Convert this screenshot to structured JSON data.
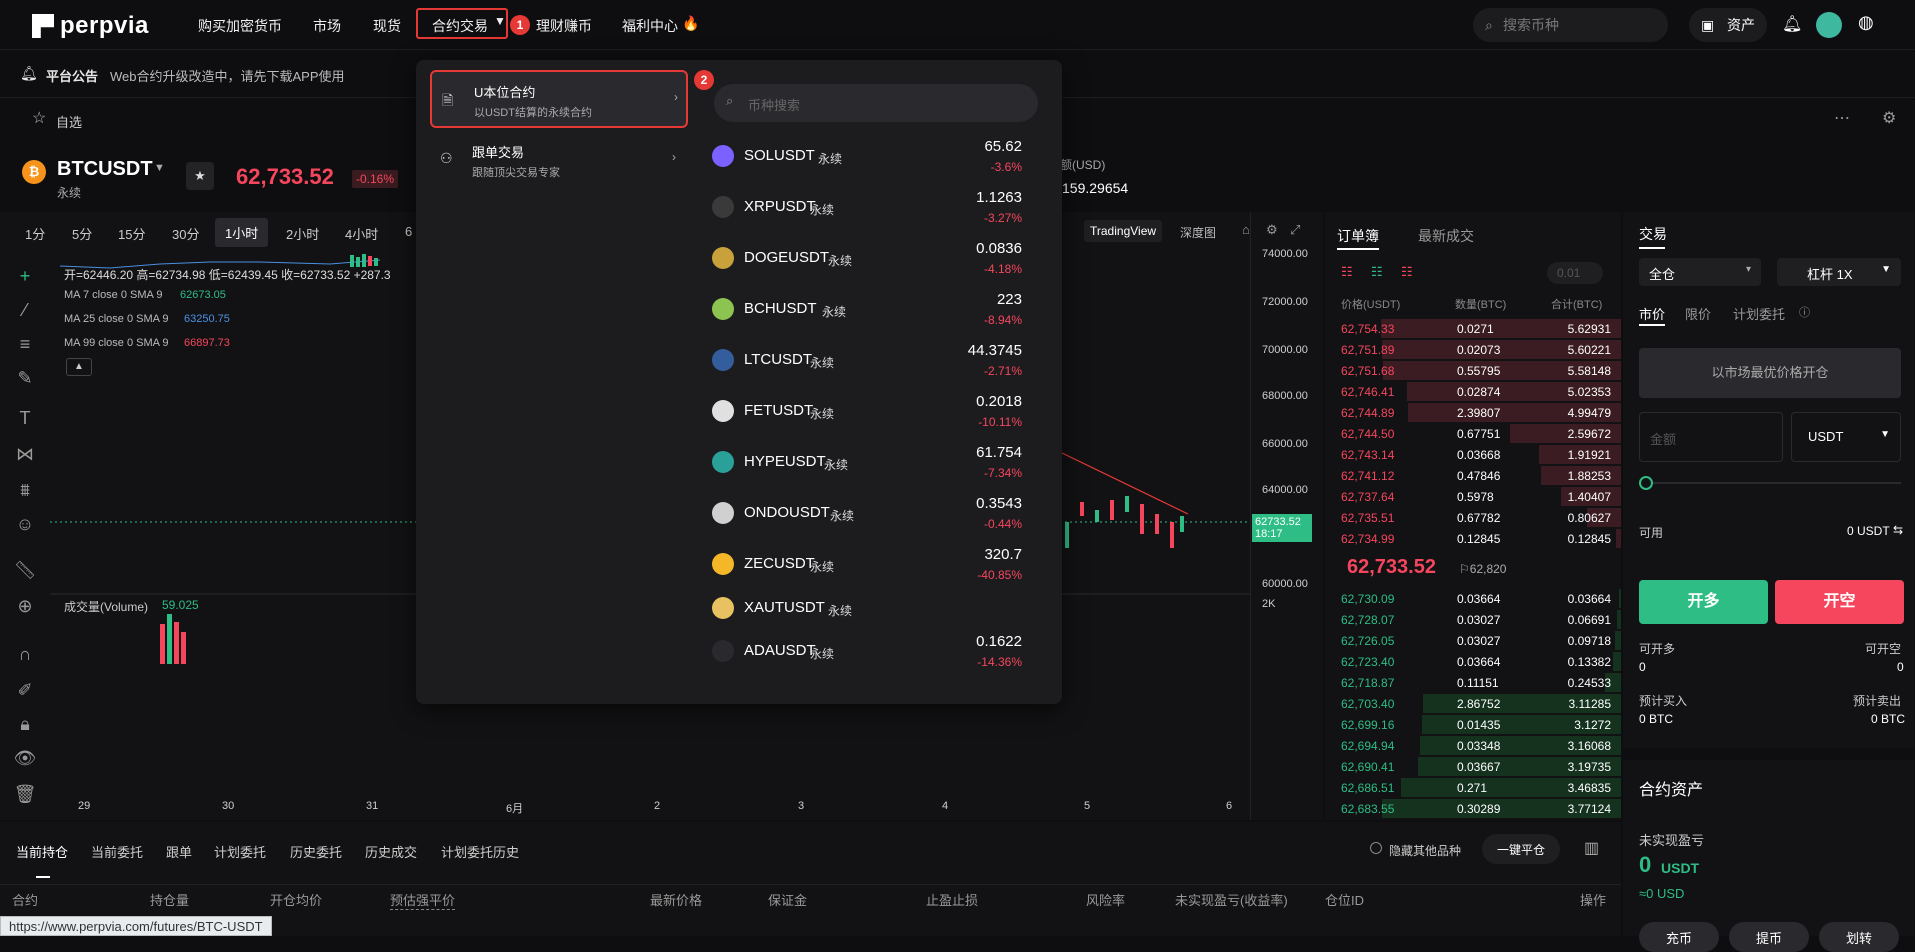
{
  "header": {
    "logo": "perpvia",
    "nav": [
      "购买加密货币",
      "市场",
      "现货",
      "合约交易",
      "理财赚币",
      "福利中心"
    ],
    "badge1": "1",
    "badge2": "2",
    "search_placeholder": "搜索币种",
    "asset_label": "资产"
  },
  "announce": {
    "title": "平台公告",
    "text": "Web合约升级改造中，请先下载APP使用"
  },
  "favrow": {
    "label": "自选"
  },
  "ticker": {
    "symbol": "BTCUSDT",
    "sub": "永续",
    "price": "62,733.52",
    "change": "-0.16%",
    "extra_label": "额(USD)",
    "extra_value": "159.29654"
  },
  "chart": {
    "intervals": [
      "1分",
      "5分",
      "15分",
      "30分",
      "1小时",
      "2小时",
      "4小时",
      "6"
    ],
    "view_tabs": [
      "TradingView",
      "深度图"
    ],
    "ohlc": "开=62446.20 高=62734.98 低=62439.45 收=62733.52 +287.3",
    "ma7": "MA 7 close 0 SMA 9",
    "ma7_val": "62673.05",
    "ma25": "MA 25 close 0 SMA 9",
    "ma25_val": "63250.75",
    "ma99": "MA 99 close 0 SMA 9",
    "ma99_val": "66897.73",
    "volume_label": "成交量(Volume)",
    "volume_val": "59.025",
    "y_labels": [
      "74000.00",
      "72000.00",
      "70000.00",
      "68000.00",
      "66000.00",
      "64000.00",
      "60000.00",
      "2K"
    ],
    "x_labels": [
      "29",
      "30",
      "31",
      "6月",
      "2",
      "3",
      "4",
      "5",
      "6"
    ],
    "last_price": "62733.52",
    "last_time": "18:17"
  },
  "orderbook": {
    "tabs": [
      "订单簿",
      "最新成交"
    ],
    "precision": "0.01",
    "cols": [
      "价格(USDT)",
      "数量(BTC)",
      "合计(BTC)"
    ],
    "asks": [
      [
        "62,754.33",
        "0.0271",
        "5.62931"
      ],
      [
        "62,751.89",
        "0.02073",
        "5.60221"
      ],
      [
        "62,751.68",
        "0.55795",
        "5.58148"
      ],
      [
        "62,746.41",
        "0.02874",
        "5.02353"
      ],
      [
        "62,744.89",
        "2.39807",
        "4.99479"
      ],
      [
        "62,744.50",
        "0.67751",
        "2.59672"
      ],
      [
        "62,743.14",
        "0.03668",
        "1.91921"
      ],
      [
        "62,741.12",
        "0.47846",
        "1.88253"
      ],
      [
        "62,737.64",
        "0.5978",
        "1.40407"
      ],
      [
        "62,735.51",
        "0.67782",
        "0.80627"
      ],
      [
        "62,734.99",
        "0.12845",
        "0.12845"
      ]
    ],
    "mid_price": "62,733.52",
    "mark_price": "62,820",
    "bids": [
      [
        "62,730.09",
        "0.03664",
        "0.03664"
      ],
      [
        "62,728.07",
        "0.03027",
        "0.06691"
      ],
      [
        "62,726.05",
        "0.03027",
        "0.09718"
      ],
      [
        "62,723.40",
        "0.03664",
        "0.13382"
      ],
      [
        "62,718.87",
        "0.11151",
        "0.24533"
      ],
      [
        "62,703.40",
        "2.86752",
        "3.11285"
      ],
      [
        "62,699.16",
        "0.01435",
        "3.1272"
      ],
      [
        "62,694.94",
        "0.03348",
        "3.16068"
      ],
      [
        "62,690.41",
        "0.03667",
        "3.19735"
      ],
      [
        "62,686.51",
        "0.271",
        "3.46835"
      ],
      [
        "62,683.55",
        "0.30289",
        "3.77124"
      ]
    ]
  },
  "trade": {
    "title": "交易",
    "margin_mode": "全仓",
    "leverage": "杠杆 1X",
    "order_tabs": [
      "市价",
      "限价",
      "计划委托"
    ],
    "market_btn": "以市场最优价格开仓",
    "amount_placeholder": "金额",
    "unit": "USDT",
    "available_label": "可用",
    "available_val": "0 USDT",
    "long_btn": "开多",
    "short_btn": "开空",
    "can_long": "可开多",
    "can_short": "可开空",
    "can_long_val": "0",
    "can_short_val": "0",
    "est_buy": "预计买入",
    "est_sell": "预计卖出",
    "est_buy_val": "0 BTC",
    "est_sell_val": "0 BTC"
  },
  "assets": {
    "title": "合约资产",
    "unrealized": "未实现盈亏",
    "value": "0",
    "unit": "USDT",
    "approx": "≈0 USD",
    "buttons": [
      "充币",
      "提币",
      "划转"
    ]
  },
  "bottom": {
    "tabs": [
      "当前持仓",
      "当前委托",
      "跟单",
      "计划委托",
      "历史委托",
      "历史成交",
      "计划委托历史"
    ],
    "hide_other": "隐藏其他品种",
    "close_all": "一键平仓",
    "cols": [
      "合约",
      "持仓量",
      "开仓均价",
      "预估强平价",
      "最新价格",
      "保证金",
      "止盈止损",
      "风险率",
      "未实现盈亏(收益率)",
      "仓位ID",
      "操作"
    ]
  },
  "dropdown": {
    "menu": [
      {
        "title": "U本位合约",
        "desc": "以USDT结算的永续合约"
      },
      {
        "title": "跟单交易",
        "desc": "跟随顶尖交易专家"
      }
    ],
    "search_placeholder": "币种搜索",
    "coins": [
      {
        "sym": "SOLUSDT",
        "tag": "永续",
        "price": "65.62",
        "chg": "-3.6%",
        "color": "#7b61ff"
      },
      {
        "sym": "XRPUSDT",
        "tag": "永续",
        "price": "1.1263",
        "chg": "-3.27%",
        "color": "#3a3a3a"
      },
      {
        "sym": "DOGEUSDT",
        "tag": "永续",
        "price": "0.0836",
        "chg": "-4.18%",
        "color": "#c8a13a"
      },
      {
        "sym": "BCHUSDT",
        "tag": "永续",
        "price": "223",
        "chg": "-8.94%",
        "color": "#8dc351"
      },
      {
        "sym": "LTCUSDT",
        "tag": "永续",
        "price": "44.3745",
        "chg": "-2.71%",
        "color": "#345d9d"
      },
      {
        "sym": "FETUSDT",
        "tag": "永续",
        "price": "0.2018",
        "chg": "-10.11%",
        "color": "#e0e0e0"
      },
      {
        "sym": "HYPEUSDT",
        "tag": "永续",
        "price": "61.754",
        "chg": "-7.34%",
        "color": "#2aa198"
      },
      {
        "sym": "ONDOUSDT",
        "tag": "永续",
        "price": "0.3543",
        "chg": "-0.44%",
        "color": "#d0d0d0"
      },
      {
        "sym": "ZECUSDT",
        "tag": "永续",
        "price": "320.7",
        "chg": "-40.85%",
        "color": "#f4b728"
      },
      {
        "sym": "XAUTUSDT",
        "tag": "永续",
        "price": "",
        "chg": "",
        "color": "#e8c160"
      },
      {
        "sym": "ADAUSDT",
        "tag": "永续",
        "price": "0.1622",
        "chg": "-14.36%",
        "color": "#2a2a2e"
      }
    ]
  },
  "statusbar": {
    "url": "https://www.perpvia.com/futures/BTC-USDT"
  },
  "colors": {
    "up": "#2ebd85",
    "down": "#f6465d",
    "accent_red": "#e53935",
    "bg": "#0e0e10"
  }
}
